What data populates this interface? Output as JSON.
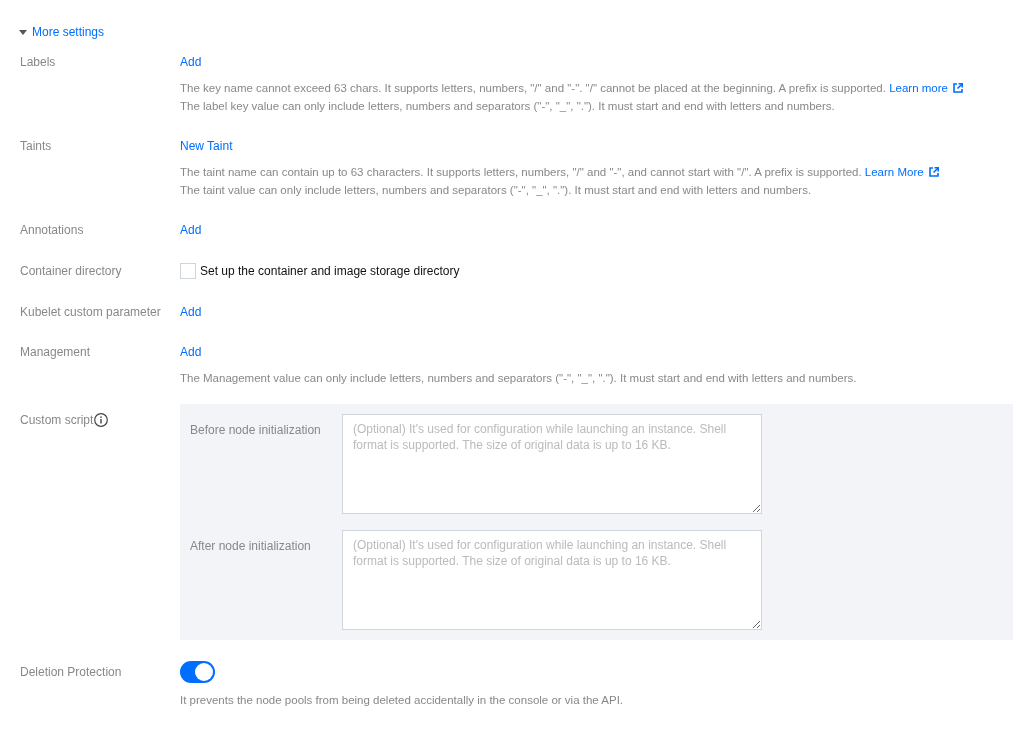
{
  "more_settings": {
    "label": "More settings",
    "expanded": true
  },
  "fields": [
    {
      "kind": "action",
      "label": "Labels",
      "action": "Add",
      "help": [
        {
          "text": "The key name cannot exceed 63 chars. It supports letters, numbers, \"/\" and \"-\". \"/\" cannot be placed at the beginning. A prefix is supported.",
          "link": "Learn more"
        },
        {
          "text": "The label key value can only include letters, numbers and separators (\"-\", \"_\", \".\"). It must start and end with letters and numbers."
        }
      ]
    },
    {
      "kind": "action",
      "label": "Taints",
      "action": "New Taint",
      "help": [
        {
          "text": "The taint name can contain up to 63 characters. It supports letters, numbers, \"/\" and \"-\", and cannot start with \"/\". A prefix is supported.",
          "link": "Learn More"
        },
        {
          "text": "The taint value can only include letters, numbers and separators (\"-\", \"_\", \".\"). It must start and end with letters and numbers."
        }
      ]
    },
    {
      "kind": "action",
      "label": "Annotations",
      "action": "Add"
    },
    {
      "kind": "checkbox",
      "label": "Container directory",
      "checkbox": {
        "label": "Set up the container and image storage directory",
        "checked": false
      }
    },
    {
      "kind": "action",
      "label": "Kubelet custom parameter",
      "action": "Add"
    },
    {
      "kind": "action",
      "label": "Management",
      "action": "Add",
      "help": [
        {
          "text": "The Management value can only include letters, numbers and separators (\"-\", \"_\", \".\"). It must start and end with letters and numbers."
        }
      ]
    },
    {
      "kind": "scripts",
      "label": "Custom script",
      "scripts": [
        {
          "label": "Before node initialization",
          "placeholder": "(Optional) It's used for configuration while launching an instance. Shell format is supported. The size of original data is up to 16 KB."
        },
        {
          "label": "After node initialization",
          "placeholder": "(Optional) It's used for configuration while launching an instance. Shell format is supported. The size of original data is up to 16 KB."
        }
      ]
    },
    {
      "kind": "toggle",
      "label": "Deletion Protection",
      "on": true,
      "help": [
        {
          "text": "It prevents the node pools from being deleted accidentally in the console or via the API."
        }
      ]
    }
  ]
}
